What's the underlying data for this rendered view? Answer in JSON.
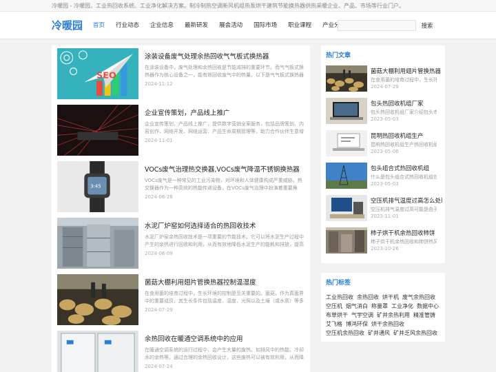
{
  "topbar": {
    "text": "冷暖园 - 冷暖园，工业热回收系统、工业净化解决方案。制冷制热空调新风机组热泵烘干建筑节能换热器供热采暖企业、产品、市场等行业门户。"
  },
  "header": {
    "logo": "冷暖园",
    "nav": [
      "首页",
      "行业动态",
      "企业信息",
      "最新研发",
      "展会活动",
      "国际市场",
      "职业课程",
      "产业分类"
    ],
    "search_placeholder": "",
    "search_label": "搜索"
  },
  "articles": [
    {
      "title": "涂装设备废气处理余热回收气气板式换热器",
      "summary": "在涂装设备中，废气处理和余热回收是节能减排的重要环节。而气气板式换热器作为核心设备之一，能有效回收废气中的热量。以下是气气板式换热器的工作原理与优势介绍。",
      "date": "2024-11-12",
      "thumb": "seo"
    },
    {
      "title": "企业宣传策划，产品线上推广",
      "summary": "企业宣传策划，产品线上推广，提供数字营销全案服务，包括品牌策划、内容创作、网络开发、网络运营、产品生命周期管理等，助力合作伙伴生意增长。",
      "date": "2024-11-01",
      "thumb": "laser"
    },
    {
      "title": "VOCs废气治理热交换器,VOCs废气降温不锈钢换热器",
      "summary": "VOCs废气是一种常见的工业污染物，对环境和人体健康构成严重威胁。热交换器作为一种高效的热能传递设备，在VOCs废气治理中扮演着重要角色。",
      "date": "2024-08-28",
      "thumb": "watch"
    },
    {
      "title": "水泥厂炉窑如何选择适合的热回收技术",
      "summary": "水泥厂炉窑余热回收技术是一项重要的节能技术。它可以将水泥生产过程中产生的余热进行回收和利用，从而有效地降低水泥生产的能耗和排放，提高经济效益。",
      "date": "2024-08-09",
      "thumb": "factory"
    },
    {
      "title": "菌菇大棚利用翅片管换热器控制温湿度",
      "summary": "在食用菌的培育过程中，生长环境的控制是至关重要的。菌菇，作为真菌界中的重要成员，其生长条件包括温度、湿度、光照以及土壤（或水质）等多种因素。",
      "date": "2024-07-29",
      "thumb": "mushroom"
    },
    {
      "title": "余热回收在暖通空调系统中的应用",
      "summary": "在暖通空调系统的运行过程中，会产生大量的废热。如排风中的热能、冷却水的余热等。通过合理的余热回收设计，这些废热可以被有效利用，从而降低能耗。",
      "date": "2024-07-24",
      "thumb": "cabinet"
    }
  ],
  "sidebar": {
    "hot_title": "热门文章",
    "hot": [
      {
        "title": "菌菇大棚利用翅片管换热器",
        "summary": "在食用菌的培育过程中，生长环境",
        "date": "2024-07-29",
        "thumb": "mushroom"
      },
      {
        "title": "包头热回收机组厂家",
        "summary": "包头热回收机组厂家介绍包头市",
        "date": "2023-05-03",
        "thumb": "laptop"
      },
      {
        "title": "昆明热回收机组生产",
        "summary": "昆明热回收机组生产热回收机组是",
        "date": "2023-05-06",
        "thumb": "laptop2"
      },
      {
        "title": "包头组合式热回收机组",
        "summary": "什么是包头组合式热回收机组包头",
        "date": "2023-05-03",
        "thumb": "tower"
      },
      {
        "title": "空压机排气温度过高怎么处理",
        "summary": "空压机排气温度过高可能是由于冷",
        "date": "2023-11-01",
        "thumb": "desk"
      },
      {
        "title": "柿子烘干机余热回收柿饼",
        "summary": "柿子烘干机余热回收和柿饼热风烘",
        "date": "2023-10-26",
        "thumb": "factory2"
      }
    ],
    "tags_title": "热门标签",
    "tags": [
      "工业热回收",
      "余热回收",
      "烘干机",
      "废气余热回收",
      "空压机",
      "烟气消白",
      "称量罩",
      "工业净化",
      "数据中心",
      "布草烘干",
      "气宇空调",
      "矿井余热利用",
      "精准管铸",
      "艾飞格",
      "博鸿环保",
      "烘干余热回收",
      "空压机余热回收",
      "矿井通风",
      "矿井乏风余热回收"
    ]
  }
}
